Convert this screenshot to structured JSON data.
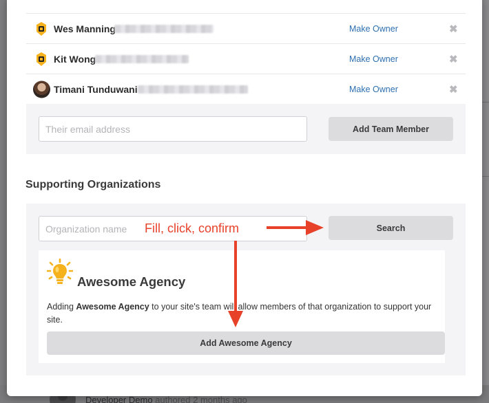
{
  "team": {
    "members": [
      {
        "name": "Wes Manning",
        "action": "Make Owner",
        "remove": "✖"
      },
      {
        "name": "Kit Wong",
        "action": "Make Owner",
        "remove": "✖"
      },
      {
        "name": "Timani Tunduwani",
        "action": "Make Owner",
        "remove": "✖"
      }
    ],
    "email_placeholder": "Their email address",
    "add_button": "Add Team Member"
  },
  "orgs": {
    "title": "Supporting Organizations",
    "search_placeholder": "Organization name",
    "search_button": "Search",
    "result": {
      "name": "Awesome Agency",
      "desc_prefix": "Adding ",
      "desc_org": "Awesome Agency",
      "desc_suffix": " to your site's team will allow members of that organization to support your site.",
      "add_button": "Add Awesome Agency"
    }
  },
  "annotation": {
    "text": "Fill, click, confirm",
    "color": "#e8412a"
  },
  "background": {
    "footer_name": "Developer Demo",
    "footer_meta": "authored 2 months ago"
  },
  "colors": {
    "link": "#2d6fb0",
    "panel": "#f4f4f7",
    "button": "#dcdcdf",
    "bulb": "#f5b21d"
  }
}
